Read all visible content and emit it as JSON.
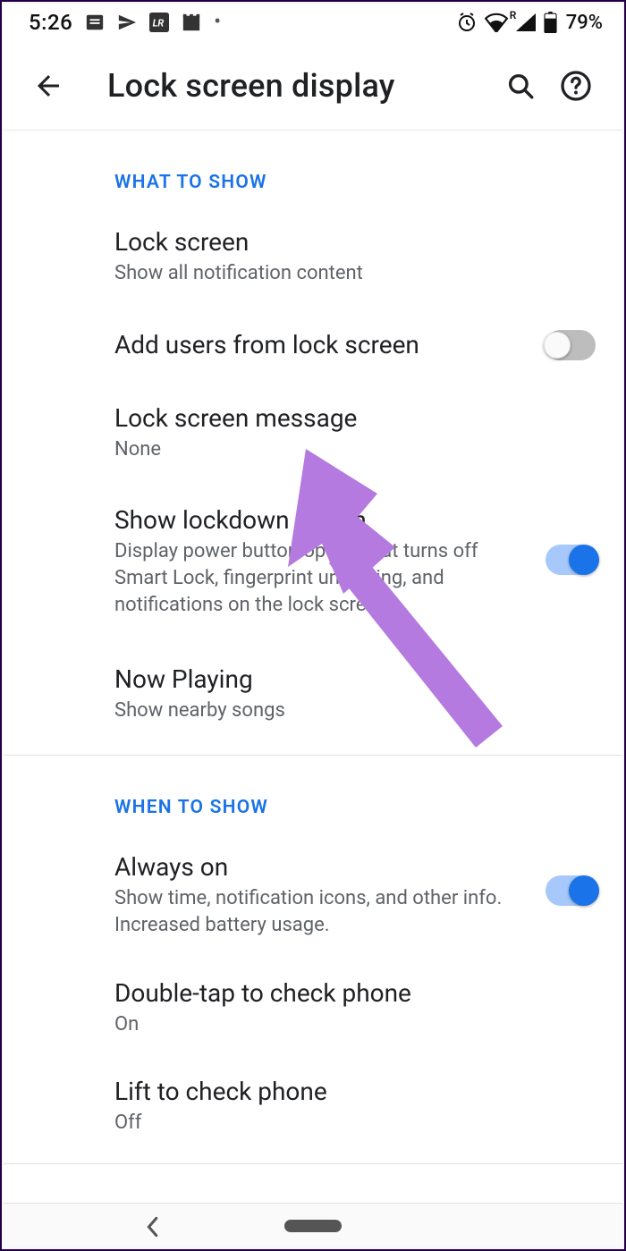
{
  "status": {
    "time": "5:26",
    "battery": "79%",
    "roaming": "R"
  },
  "header": {
    "title": "Lock screen display"
  },
  "sections": [
    {
      "id": "what",
      "header": "WHAT TO SHOW",
      "items": [
        {
          "title": "Lock screen",
          "subtitle": "Show all notification content"
        },
        {
          "title": "Add users from lock screen",
          "toggle": false
        },
        {
          "title": "Lock screen message",
          "subtitle": "None"
        },
        {
          "title": "Show lockdown option",
          "subtitle": "Display power button option that turns off Smart Lock, fingerprint unlocking, and notifications on the lock screen",
          "toggle": true
        },
        {
          "title": "Now Playing",
          "subtitle": "Show nearby songs"
        }
      ]
    },
    {
      "id": "when",
      "header": "WHEN TO SHOW",
      "items": [
        {
          "title": "Always on",
          "subtitle": "Show time, notification icons, and other info. Increased battery usage.",
          "toggle": true
        },
        {
          "title": "Double-tap to check phone",
          "subtitle": "On"
        },
        {
          "title": "Lift to check phone",
          "subtitle": "Off"
        }
      ]
    }
  ],
  "annotation": {
    "color": "#b57ae0"
  }
}
